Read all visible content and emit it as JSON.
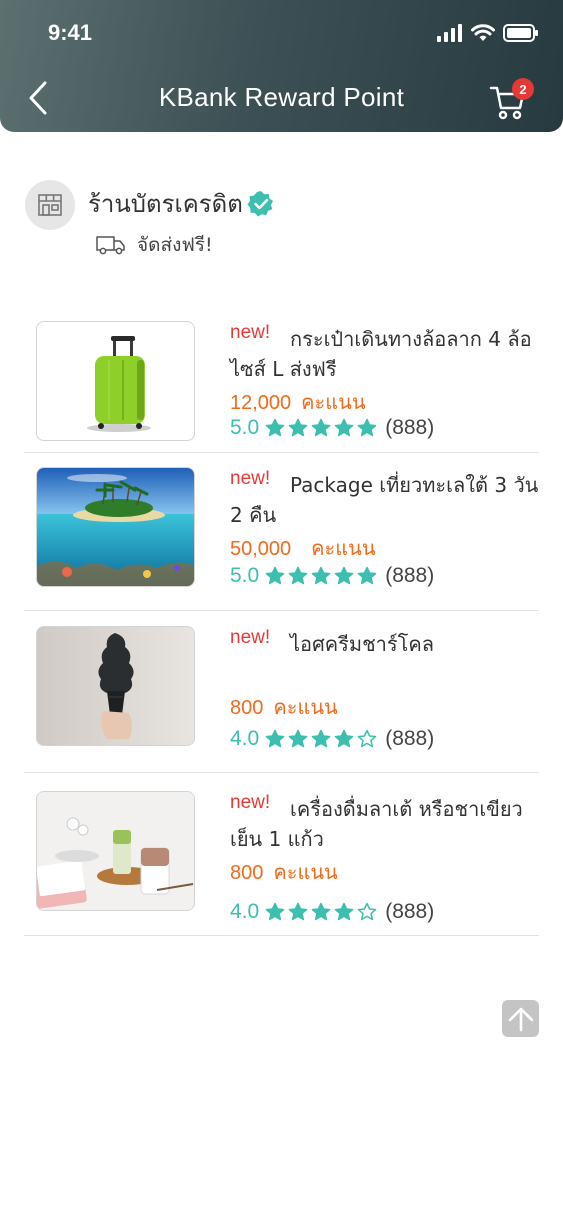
{
  "status_bar": {
    "time": "9:41"
  },
  "header": {
    "title": "KBank Reward Point",
    "cart_count": "2"
  },
  "store": {
    "name": "ร้านบัตรเครดิต",
    "delivery_text": "จัดส่งฟรี!"
  },
  "products": [
    {
      "tag": "new!",
      "name": "กระเป๋าเดินทางล้อลาก 4 ล้อ ไซส์ L ส่งฟรี",
      "price": "12,000",
      "price_unit": "คะแนน",
      "score": "5.0",
      "rating": 5,
      "count": "(888)",
      "image": "green-suitcase"
    },
    {
      "tag": "new!",
      "name": "Package เที่ยวทะเลใต้ 3 วัน 2 คืน",
      "price": "50,000",
      "price_unit": "คะแนน",
      "score": "5.0",
      "rating": 5,
      "count": "(888)",
      "image": "tropical-island"
    },
    {
      "tag": "new!",
      "name": "ไอศครีมชาร์โคล",
      "price": "800",
      "price_unit": "คะแนน",
      "score": "4.0",
      "rating": 4,
      "count": "(888)",
      "image": "charcoal-ice-cream"
    },
    {
      "tag": "new!",
      "name": "เครื่องดื่มลาเต้ หรือชาเขียวเย็น 1 แก้ว",
      "price": "800",
      "price_unit": "คะแนน",
      "score": "4.0",
      "rating": 4,
      "count": "(888)",
      "image": "latte-green-tea"
    }
  ],
  "colors": {
    "header_dark": "#263a40",
    "header_light": "#5c7070",
    "new_tag": "#e53935",
    "price": "#f26a1b",
    "rating": "#3cbfae",
    "verified": "#3cbfae",
    "badge": "#e53935"
  }
}
